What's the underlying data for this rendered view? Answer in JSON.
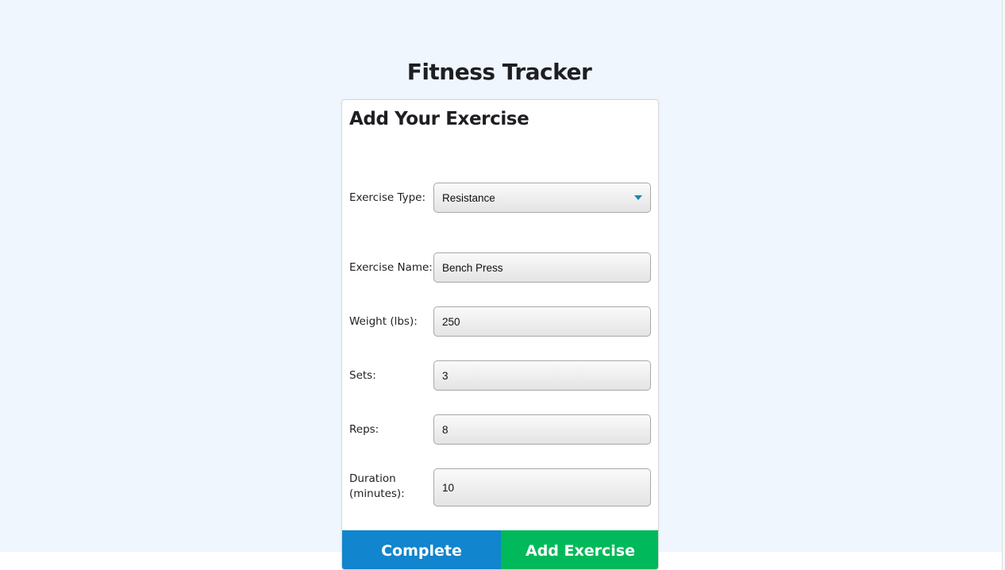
{
  "page": {
    "title": "Fitness Tracker"
  },
  "form": {
    "title": "Add Your Exercise",
    "fields": [
      {
        "label": "Exercise Type:",
        "value": "Resistance",
        "type": "select"
      },
      {
        "label": "Exercise Name:",
        "value": "Bench Press",
        "type": "text"
      },
      {
        "label": "Weight (lbs):",
        "value": "250",
        "type": "number"
      },
      {
        "label": "Sets:",
        "value": "3",
        "type": "number"
      },
      {
        "label": "Reps:",
        "value": "8",
        "type": "number"
      },
      {
        "label": "Duration (minutes):",
        "value": "10",
        "type": "number"
      }
    ],
    "buttons": {
      "complete": "Complete",
      "add_exercise": "Add Exercise"
    }
  },
  "colors": {
    "background": "#eff6fe",
    "complete_button": "#1185cd",
    "add_button": "#00b95a",
    "select_caret": "#1a86b4"
  },
  "icons": {
    "select_caret": "caret-down-icon"
  }
}
